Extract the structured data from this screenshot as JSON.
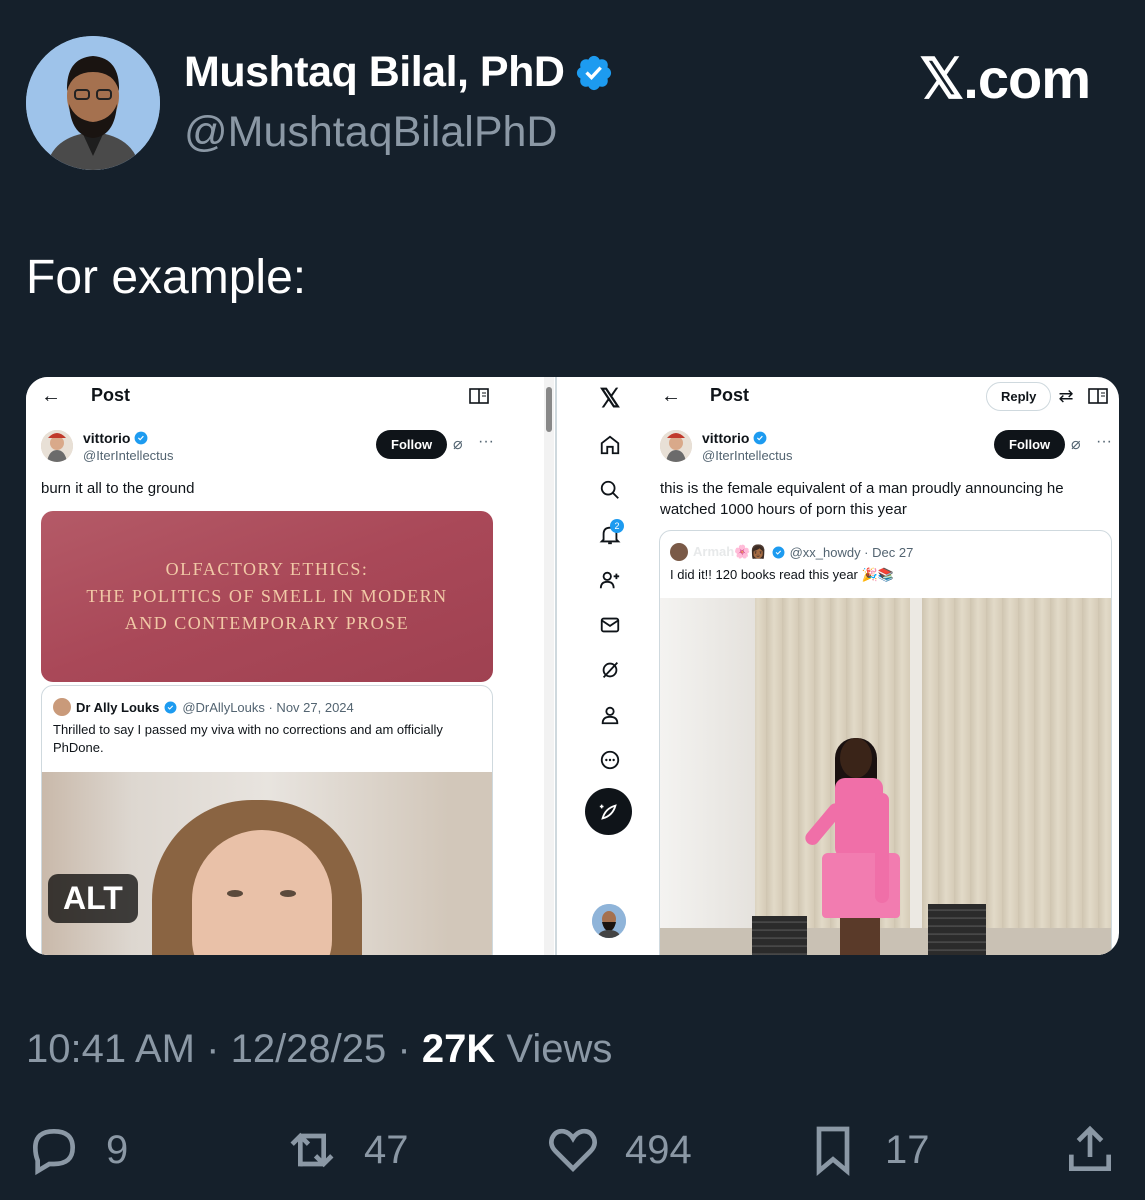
{
  "author": {
    "name": "Mushtaq Bilal, PhD",
    "handle": "@MushtaqBilalPhD",
    "verified": true
  },
  "site_logo": "𝕏.com",
  "tweet_text": "For example:",
  "media": {
    "alt_badge": "ALT",
    "left_screenshot": {
      "top_title": "Post",
      "user_name": "vittorio",
      "user_handle": "@IterIntellectus",
      "follow_label": "Follow",
      "post_text": "burn it all to the ground",
      "book_title_lines": [
        "OLFACTORY ETHICS:",
        "THE POLITICS OF SMELL IN MODERN",
        "AND CONTEMPORARY PROSE"
      ],
      "quote": {
        "name": "Dr Ally Louks",
        "handle_date": "@DrAllyLouks · Nov 27, 2024",
        "text": "Thrilled to say I passed my viva with no corrections and am officially PhDone."
      }
    },
    "sidebar": {
      "notification_count": "2",
      "icons": [
        "x-logo",
        "home-icon",
        "search-icon",
        "bell-icon",
        "add-person-icon",
        "mail-icon",
        "grok-icon",
        "profile-icon",
        "more-icon"
      ]
    },
    "right_screenshot": {
      "top_title": "Post",
      "reply_label": "Reply",
      "user_name": "vittorio",
      "user_handle": "@IterIntellectus",
      "follow_label": "Follow",
      "post_text": "this is the female equivalent of a man proudly announcing he watched 1000 hours of porn this year",
      "quote": {
        "name": "Armah🌸👩🏾",
        "handle_date": "@xx_howdy · Dec 27",
        "text": "I did it!! 120 books read this year 🎉📚"
      }
    }
  },
  "meta": {
    "time": "10:41 AM",
    "date": "12/28/25",
    "views_count": "27K",
    "views_label": "Views"
  },
  "actions": {
    "replies": "9",
    "reposts": "47",
    "likes": "494",
    "bookmarks": "17"
  },
  "colors": {
    "background": "#15202b",
    "accent": "#1d9bf0",
    "muted": "#8b98a5"
  }
}
